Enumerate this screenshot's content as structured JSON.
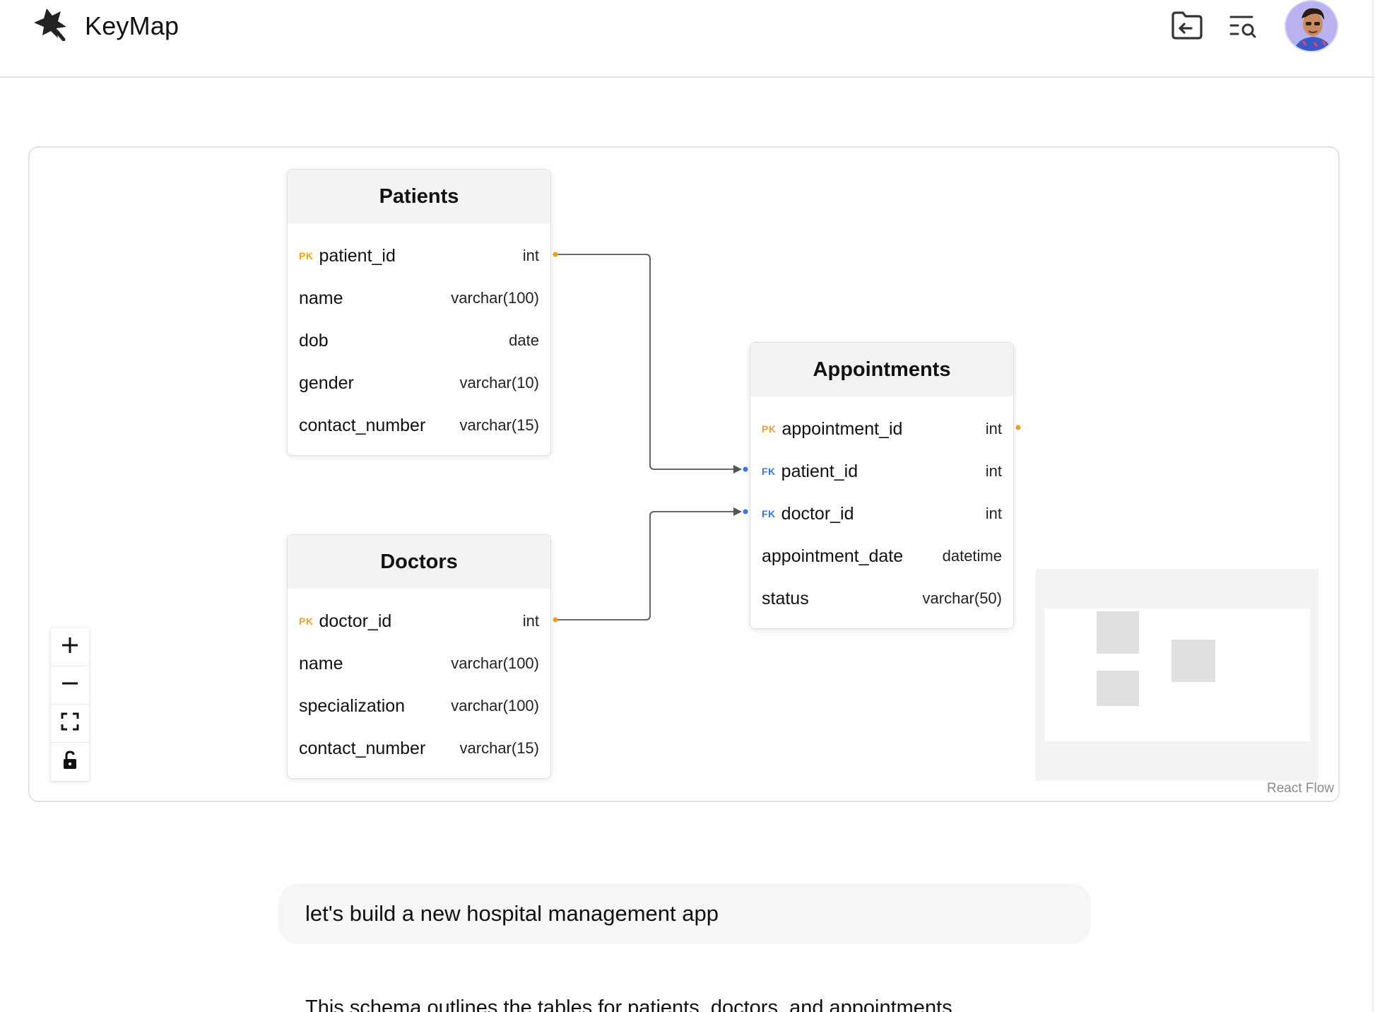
{
  "app": {
    "name": "KeyMap"
  },
  "header": {
    "icons": [
      "folder-import-icon",
      "search-list-icon"
    ],
    "avatar": "user-avatar"
  },
  "canvas": {
    "attribution": "React Flow",
    "controls": [
      "zoom-in",
      "zoom-out",
      "fit-view",
      "lock"
    ],
    "tables": {
      "patients": {
        "title": "Patients",
        "columns": [
          {
            "key": "PK",
            "name": "patient_id",
            "type": "int"
          },
          {
            "key": "",
            "name": "name",
            "type": "varchar(100)"
          },
          {
            "key": "",
            "name": "dob",
            "type": "date"
          },
          {
            "key": "",
            "name": "gender",
            "type": "varchar(10)"
          },
          {
            "key": "",
            "name": "contact_number",
            "type": "varchar(15)"
          }
        ]
      },
      "doctors": {
        "title": "Doctors",
        "columns": [
          {
            "key": "PK",
            "name": "doctor_id",
            "type": "int"
          },
          {
            "key": "",
            "name": "name",
            "type": "varchar(100)"
          },
          {
            "key": "",
            "name": "specialization",
            "type": "varchar(100)"
          },
          {
            "key": "",
            "name": "contact_number",
            "type": "varchar(15)"
          }
        ]
      },
      "appointments": {
        "title": "Appointments",
        "columns": [
          {
            "key": "PK",
            "name": "appointment_id",
            "type": "int"
          },
          {
            "key": "FK",
            "name": "patient_id",
            "type": "int"
          },
          {
            "key": "FK",
            "name": "doctor_id",
            "type": "int"
          },
          {
            "key": "",
            "name": "appointment_date",
            "type": "datetime"
          },
          {
            "key": "",
            "name": "status",
            "type": "varchar(50)"
          }
        ]
      }
    }
  },
  "chat": {
    "user_message": "let's build a new hospital management app",
    "assistant_message": "This schema outlines the tables for patients, doctors, and appointments."
  },
  "colors": {
    "pk": "#f0a020",
    "fk": "#3a78e0",
    "edge": "#555555",
    "header_bg": "#f3f3f3"
  }
}
